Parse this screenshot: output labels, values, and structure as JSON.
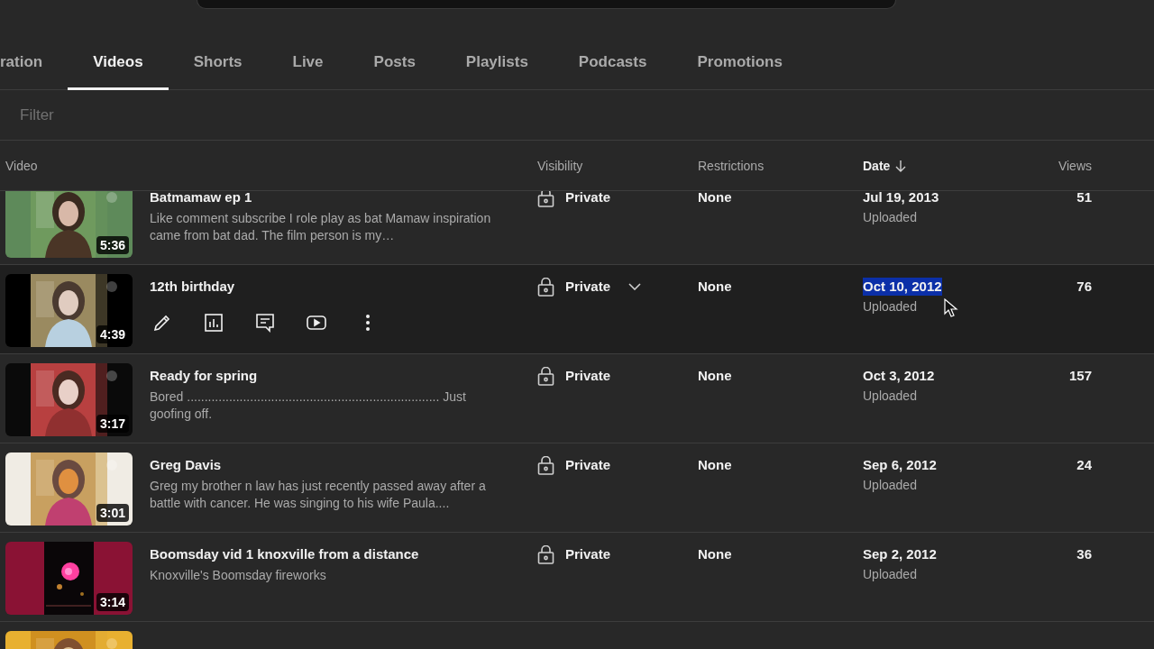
{
  "tabs": [
    {
      "label": "ration",
      "selected": false
    },
    {
      "label": "Videos",
      "selected": true
    },
    {
      "label": "Shorts",
      "selected": false
    },
    {
      "label": "Live",
      "selected": false
    },
    {
      "label": "Posts",
      "selected": false
    },
    {
      "label": "Playlists",
      "selected": false
    },
    {
      "label": "Podcasts",
      "selected": false
    },
    {
      "label": "Promotions",
      "selected": false
    }
  ],
  "filter": {
    "placeholder": "Filter"
  },
  "table": {
    "columns": [
      {
        "label": "Video",
        "sorted": false
      },
      {
        "label": "Visibility",
        "sorted": false
      },
      {
        "label": "Restrictions",
        "sorted": false
      },
      {
        "label": "Date",
        "sorted": true
      },
      {
        "label": "Views",
        "sorted": false
      }
    ],
    "rows": [
      {
        "kind": "video",
        "duration": "5:36",
        "title": "Batmamaw ep 1",
        "description": "Like comment subscribe I role play as bat Mamaw inspiration came from bat dad. The film person is my…",
        "visibility": "Private",
        "restrictions": "None",
        "date": "Jul 19, 2013",
        "date_status": "Uploaded",
        "views": "51",
        "hovered": false,
        "date_highlighted": false
      },
      {
        "kind": "video",
        "duration": "4:39",
        "title": "12th birthday",
        "visibility": "Private",
        "restrictions": "None",
        "date": "Oct 10, 2012",
        "date_status": "Uploaded",
        "views": "76",
        "hovered": true,
        "date_highlighted": true
      },
      {
        "kind": "video",
        "duration": "3:17",
        "title": "Ready for spring",
        "description": "Bored ........................................................................ Just goofing off.",
        "visibility": "Private",
        "restrictions": "None",
        "date": "Oct 3, 2012",
        "date_status": "Uploaded",
        "views": "157",
        "hovered": false,
        "date_highlighted": false
      },
      {
        "kind": "video",
        "duration": "3:01",
        "title": "Greg Davis",
        "description": "Greg my brother n law has just recently passed away after a battle with cancer. He was singing to his wife Paula....",
        "visibility": "Private",
        "restrictions": "None",
        "date": "Sep 6, 2012",
        "date_status": "Uploaded",
        "views": "24",
        "hovered": false,
        "date_highlighted": false
      },
      {
        "kind": "video",
        "duration": "3:14",
        "title": "Boomsday vid 1 knoxville from a distance",
        "description": "Knoxville's Boomsday fireworks",
        "visibility": "Private",
        "restrictions": "None",
        "date": "Sep 2, 2012",
        "date_status": "Uploaded",
        "views": "36",
        "hovered": false,
        "date_highlighted": false
      },
      {
        "kind": "partial"
      }
    ]
  }
}
